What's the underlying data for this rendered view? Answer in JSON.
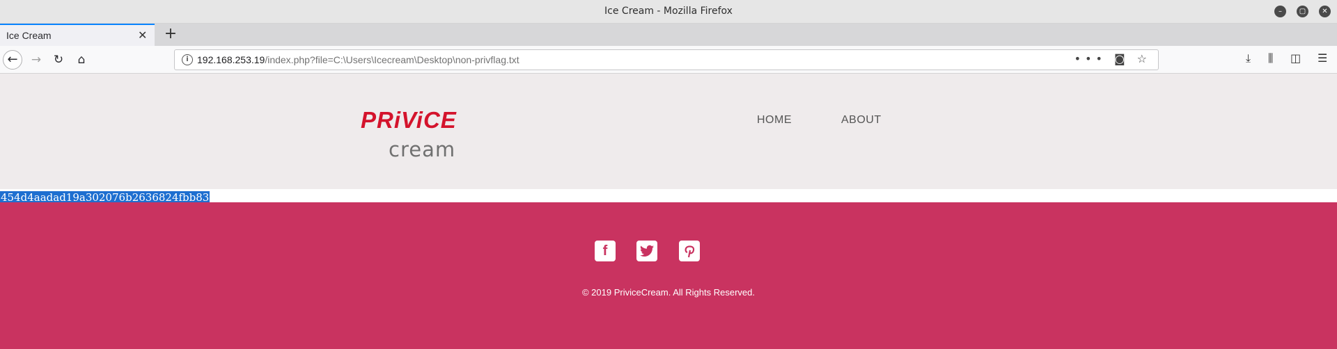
{
  "window": {
    "title": "Ice Cream - Mozilla Firefox",
    "controls": [
      "minimize-icon",
      "maximize-icon",
      "close-icon"
    ]
  },
  "tabs": [
    {
      "label": "Ice Cream",
      "active": true
    }
  ],
  "nav": {
    "url_host": "192.168.253.19",
    "url_path": "/index.php?file=C:\\Users\\Icecream\\Desktop\\non-privflag.txt",
    "page_actions": [
      "more-icon",
      "pocket-icon",
      "bookmark-star-icon"
    ],
    "toolbar_icons": [
      "download-icon",
      "library-icon",
      "sidebar-icon",
      "menu-icon"
    ]
  },
  "site": {
    "logo_top": "PRiViCE",
    "logo_bottom": "cream",
    "menu": [
      {
        "label": "HOME"
      },
      {
        "label": "ABOUT"
      }
    ],
    "flag_text": "454d4aadad19a302076b2636824fbb83",
    "social": [
      {
        "icon": "facebook-icon",
        "glyph": "f"
      },
      {
        "icon": "twitter-icon",
        "glyph": "t"
      },
      {
        "icon": "pinterest-icon",
        "glyph": "p"
      }
    ],
    "copyright": "© 2019 PriviceCream. All Rights Reserved."
  },
  "colors": {
    "brand_red": "#d4132c",
    "footer_pink": "#c93360",
    "header_bg": "#efebec",
    "selection_blue": "#1e6fd0",
    "tab_accent": "#0a84ff"
  }
}
